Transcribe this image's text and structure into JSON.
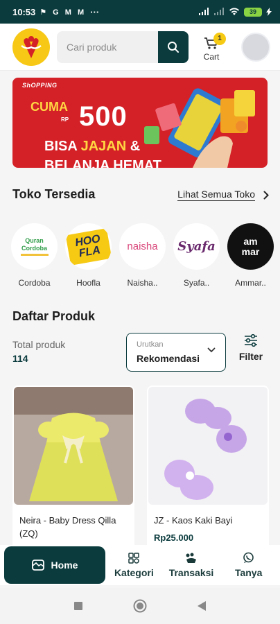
{
  "status_bar": {
    "time": "10:53",
    "notification_icons": "⚑ G M M",
    "more_indicator": "···",
    "battery": "39"
  },
  "header": {
    "search_placeholder": "Cari produk",
    "cart_label": "Cart",
    "cart_count": "1"
  },
  "banner": {
    "brand": "ShOPPING",
    "cuma": "CUMA",
    "currency": "RP",
    "price": "500",
    "line1_a": "BISA ",
    "line1_b": "JAJAN",
    "line1_c": " &",
    "line2": "BELANJA HEMAT"
  },
  "stores_section": {
    "title": "Toko Tersedia",
    "see_all": "Lihat Semua Toko",
    "stores": [
      {
        "name": "Cordoba",
        "logo_text": "Quran Cordoba"
      },
      {
        "name": "Hoofla",
        "logo_text": "HOO FLA"
      },
      {
        "name": "Naisha..",
        "logo_text": "naisha"
      },
      {
        "name": "Syafa..",
        "logo_text": "Syafa"
      },
      {
        "name": "Ammar..",
        "logo_text": "am mar"
      }
    ]
  },
  "products_section": {
    "title": "Daftar Produk",
    "total_label": "Total produk",
    "total_value": "114",
    "sort_label": "Urutkan",
    "sort_value": "Rekomendasi",
    "filter_label": "Filter",
    "products": [
      {
        "name": "Neira - Baby Dress Qilla (ZQ)",
        "price": ""
      },
      {
        "name": "JZ - Kaos Kaki Bayi",
        "price": "Rp25.000"
      }
    ]
  },
  "bottom_nav": {
    "home": "Home",
    "kategori": "Kategori",
    "transaksi": "Transaksi",
    "tanya": "Tanya"
  },
  "colors": {
    "primary": "#0b3b3d",
    "accent": "#f6c913",
    "banner_red": "#d42027"
  },
  "icons": [
    "search-icon",
    "cart-icon",
    "filter-icon",
    "chevron-right-icon",
    "chevron-down-icon",
    "home-icon",
    "kategori-icon",
    "transaksi-icon",
    "whatsapp-icon"
  ]
}
